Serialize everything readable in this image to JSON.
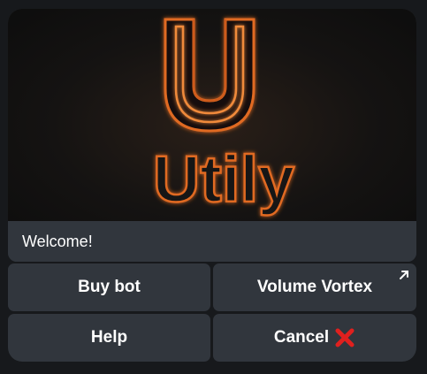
{
  "banner": {
    "logo_text": "Utily",
    "glow_color": "#e0641e"
  },
  "message": {
    "text": "Welcome!"
  },
  "keyboard": {
    "buy_label": "Buy bot",
    "volume_label": "Volume Vortex",
    "help_label": "Help",
    "cancel_label": "Cancel",
    "cancel_icon": "red-x-mark-icon",
    "volume_icon": "external-link-arrow-icon"
  }
}
